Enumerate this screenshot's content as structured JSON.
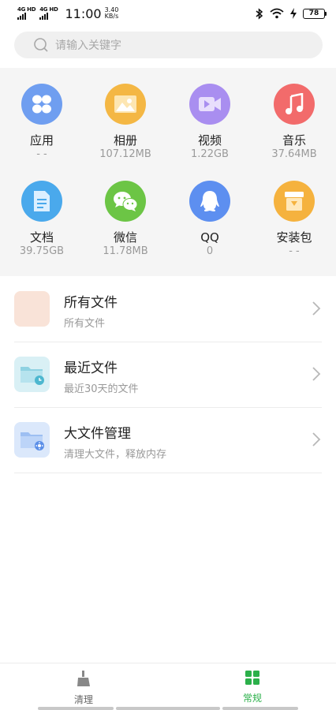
{
  "status_bar": {
    "net1": "4G HD",
    "net2": "4G HD",
    "time": "11:00",
    "speed_value": "3.40",
    "speed_unit": "KB/s",
    "battery": "78"
  },
  "search": {
    "placeholder": "请输入关键字"
  },
  "categories": [
    {
      "name": "应用",
      "size": "- -",
      "icon": "apps-icon",
      "color": "#6f9ef0"
    },
    {
      "name": "相册",
      "size": "107.12MB",
      "icon": "album-icon",
      "color": "#f4b744"
    },
    {
      "name": "视频",
      "size": "1.22GB",
      "icon": "video-icon",
      "color": "#a98ef0"
    },
    {
      "name": "音乐",
      "size": "37.64MB",
      "icon": "music-icon",
      "color": "#f26b6b"
    },
    {
      "name": "文档",
      "size": "39.75GB",
      "icon": "document-icon",
      "color": "#4aa9ec"
    },
    {
      "name": "微信",
      "size": "11.78MB",
      "icon": "wechat-icon",
      "color": "#6cc545"
    },
    {
      "name": "QQ",
      "size": "0",
      "icon": "qq-icon",
      "color": "#5d8ff0"
    },
    {
      "name": "安装包",
      "size": "- -",
      "icon": "package-icon",
      "color": "#f5b23e"
    }
  ],
  "list": [
    {
      "title": "所有文件",
      "subtitle": "所有文件",
      "icon": "all-files-icon"
    },
    {
      "title": "最近文件",
      "subtitle": "最近30天的文件",
      "icon": "recent-files-icon"
    },
    {
      "title": "大文件管理",
      "subtitle": "清理大文件，释放内存",
      "icon": "large-files-icon"
    }
  ],
  "bottom_nav": [
    {
      "label": "清理",
      "icon": "broom-icon",
      "active": false
    },
    {
      "label": "常规",
      "icon": "grid-icon",
      "active": true
    }
  ],
  "colors": {
    "accent": "#2bb04a",
    "inactive": "#666666"
  }
}
